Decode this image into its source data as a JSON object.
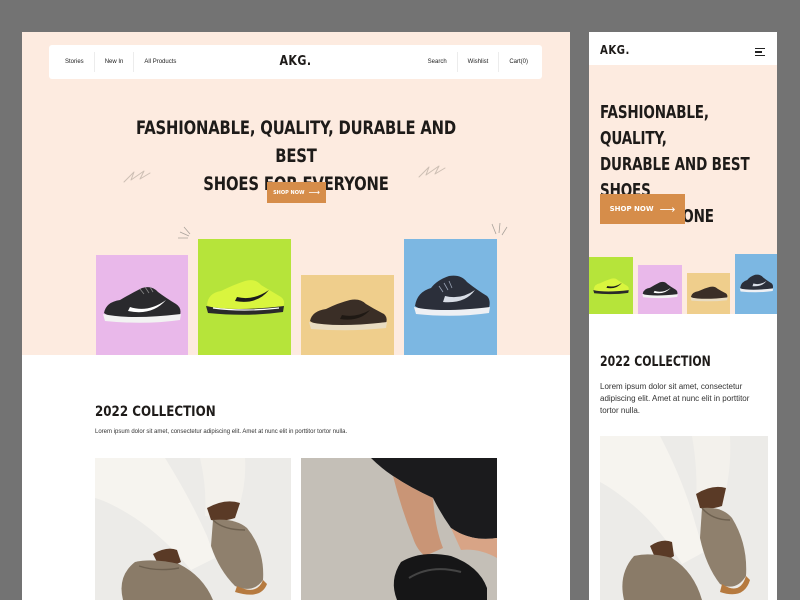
{
  "desktop": {
    "nav": {
      "left_items": [
        "Stories",
        "New In",
        "All Products"
      ],
      "logo": "AKG.",
      "right_items": [
        "Search",
        "Wishlist",
        "Cart(0)"
      ]
    },
    "hero": {
      "title_line1": "FASHIONABLE, QUALITY, DURABLE AND BEST",
      "title_line2": "SHOES FOR EVERYONE",
      "cta_label": "SHOP NOW",
      "cta_arrow": "⟶"
    },
    "collection": {
      "title": "2022 COLLECTION",
      "text": "Lorem ipsum dolor sit amet, consectetur adipiscing elit. Amet at nunc elit in porttitor tortor nulla."
    }
  },
  "mobile": {
    "logo": "AKG.",
    "hero": {
      "title_line1": "FASHIONABLE, QUALITY,",
      "title_line2": "DURABLE AND BEST SHOES",
      "title_line3": "FOR EVERYONE",
      "cta_label": "SHOP NOW",
      "cta_arrow": "⟶"
    },
    "collection": {
      "title": "2022 COLLECTION",
      "text": "Lorem ipsum dolor sit amet, consectetur adipiscing elit. Amet at nunc elit in porttitor tortor nulla."
    }
  },
  "colors": {
    "page_bg": "#737373",
    "hero_bg": "#fdebe0",
    "accent": "#d68d4a",
    "tile_pink": "#e9b8ea",
    "tile_lime": "#b6e43a",
    "tile_sand": "#efce8c",
    "tile_blue": "#7cb7e2"
  }
}
